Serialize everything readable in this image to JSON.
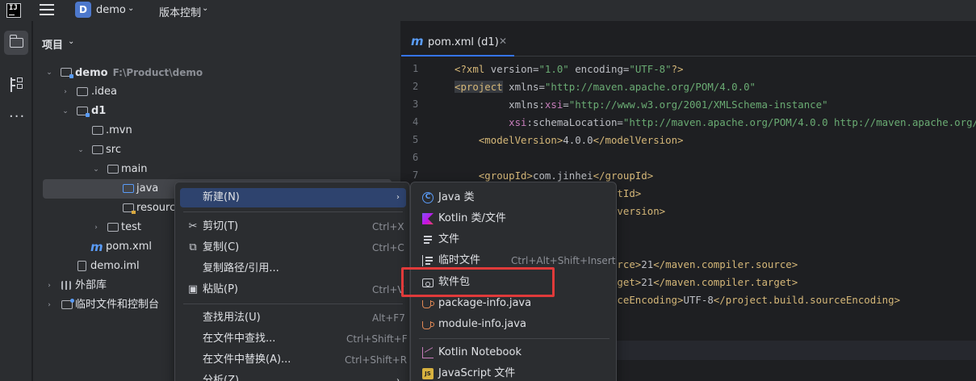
{
  "titlebar": {
    "project_badge": "D",
    "project_name": "demo",
    "vcs_label": "版本控制"
  },
  "project_panel": {
    "title": "项目",
    "tree": [
      {
        "label": "demo",
        "path": "F:\\Product\\demo",
        "icon": "module-folder-icon"
      },
      {
        "label": ".idea",
        "icon": "folder-icon"
      },
      {
        "label": "d1",
        "icon": "module-folder-icon"
      },
      {
        "label": ".mvn",
        "icon": "folder-icon"
      },
      {
        "label": "src",
        "icon": "folder-icon"
      },
      {
        "label": "main",
        "icon": "folder-icon"
      },
      {
        "label": "java",
        "icon": "source-folder-icon"
      },
      {
        "label": "resource",
        "icon": "resources-folder-icon"
      },
      {
        "label": "test",
        "icon": "folder-icon"
      },
      {
        "label": "pom.xml",
        "icon": "maven-icon"
      },
      {
        "label": "demo.iml",
        "icon": "file-icon"
      },
      {
        "label": "外部库",
        "icon": "library-icon"
      },
      {
        "label": "临时文件和控制台",
        "icon": "scratch-icon"
      }
    ]
  },
  "editor": {
    "tab_label": "pom.xml (d1)",
    "line_numbers": [
      "1",
      "2",
      "3",
      "4",
      "5",
      "6",
      "7"
    ]
  },
  "context_menu": {
    "items": [
      {
        "label": "新建(N)",
        "shortcut": "",
        "icon": ""
      },
      {
        "label": "剪切(T)",
        "shortcut": "Ctrl+X",
        "icon": "scissors-icon"
      },
      {
        "label": "复制(C)",
        "shortcut": "Ctrl+C",
        "icon": "copy-icon"
      },
      {
        "label": "复制路径/引用...",
        "shortcut": "",
        "icon": ""
      },
      {
        "label": "粘贴(P)",
        "shortcut": "Ctrl+V",
        "icon": "paste-icon"
      },
      {
        "label": "查找用法(U)",
        "shortcut": "Alt+F7",
        "icon": ""
      },
      {
        "label": "在文件中查找...",
        "shortcut": "Ctrl+Shift+F",
        "icon": ""
      },
      {
        "label": "在文件中替换(A)...",
        "shortcut": "Ctrl+Shift+R",
        "icon": ""
      },
      {
        "label": "分析(Z)",
        "shortcut": "",
        "icon": ""
      }
    ]
  },
  "submenu": {
    "items": [
      {
        "label": "Java 类",
        "shortcut": "",
        "icon": "java-class-icon"
      },
      {
        "label": "Kotlin 类/文件",
        "shortcut": "",
        "icon": "kotlin-icon"
      },
      {
        "label": "文件",
        "shortcut": "",
        "icon": "text-file-icon"
      },
      {
        "label": "临时文件",
        "shortcut": "Ctrl+Alt+Shift+Insert",
        "icon": "scratch-file-icon"
      },
      {
        "label": "软件包",
        "shortcut": "",
        "icon": "package-icon"
      },
      {
        "label": "package-info.java",
        "shortcut": "",
        "icon": "java-cup-icon"
      },
      {
        "label": "module-info.java",
        "shortcut": "",
        "icon": "java-cup-icon"
      },
      {
        "label": "Kotlin Notebook",
        "shortcut": "",
        "icon": "notebook-icon"
      },
      {
        "label": "JavaScript 文件",
        "shortcut": "",
        "icon": "javascript-icon"
      }
    ]
  },
  "colors": {
    "accent": "#3574f0",
    "menu_highlight": "#2e436e",
    "annotation_box": "#e03a3a"
  }
}
